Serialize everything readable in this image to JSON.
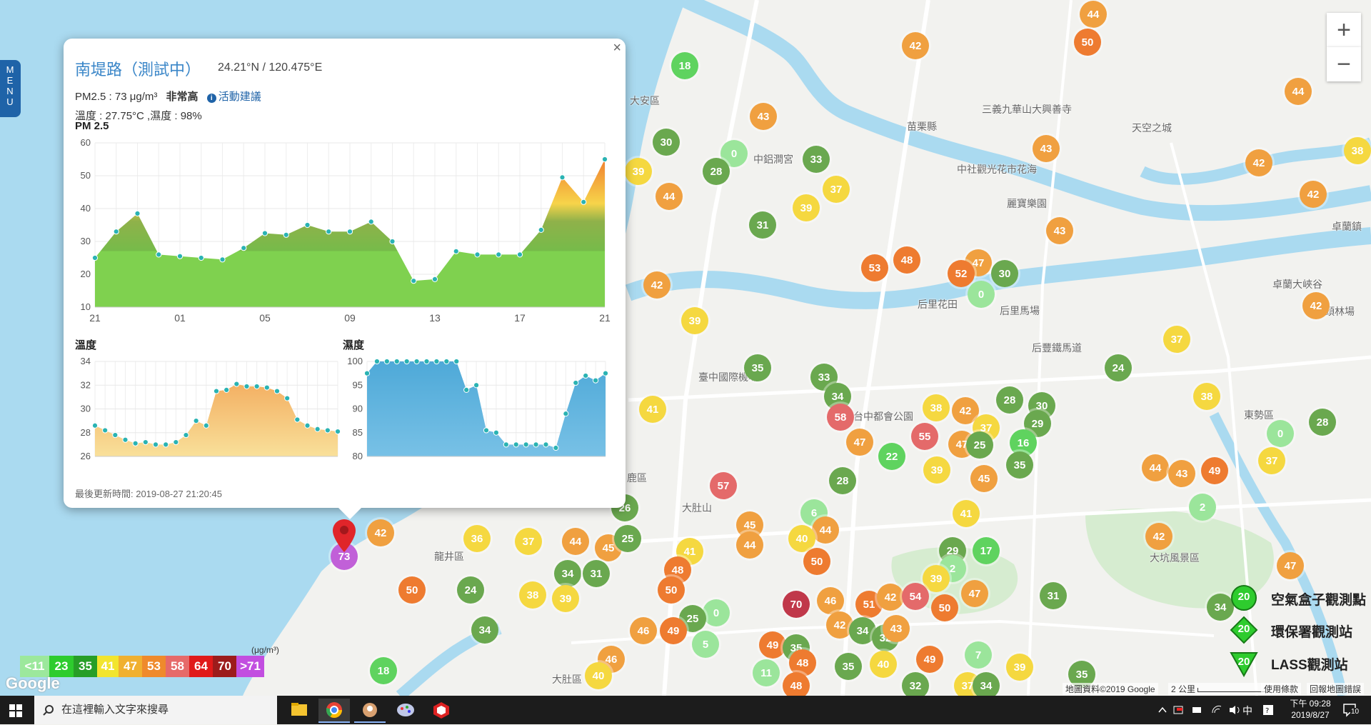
{
  "menu": {
    "label": "MENU"
  },
  "zoom": {
    "in": "+",
    "out": "−"
  },
  "places": [
    {
      "name": "大安區",
      "x": 882,
      "y": 140
    },
    {
      "name": "苗栗縣",
      "x": 1270,
      "y": 176
    },
    {
      "name": "三義九華山大興善寺",
      "x": 1375,
      "y": 152
    },
    {
      "name": "天空之城",
      "x": 1585,
      "y": 178
    },
    {
      "name": "中社觀光花市花海",
      "x": 1340,
      "y": 236
    },
    {
      "name": "卓蘭鎮",
      "x": 1865,
      "y": 316
    },
    {
      "name": "中鋁澗宮",
      "x": 1055,
      "y": 222
    },
    {
      "name": "麗寶樂園",
      "x": 1410,
      "y": 284
    },
    {
      "name": "后里花田",
      "x": 1285,
      "y": 425
    },
    {
      "name": "后里馬場",
      "x": 1400,
      "y": 434
    },
    {
      "name": "后豐鐵馬道",
      "x": 1445,
      "y": 486
    },
    {
      "name": "臺中國際機場",
      "x": 978,
      "y": 527
    },
    {
      "name": "台中都會公園",
      "x": 1195,
      "y": 582
    },
    {
      "name": "東勢區",
      "x": 1742,
      "y": 580
    },
    {
      "name": "鹿區",
      "x": 878,
      "y": 668
    },
    {
      "name": "大肚山",
      "x": 955,
      "y": 710
    },
    {
      "name": "龍井區",
      "x": 608,
      "y": 778
    },
    {
      "name": "大坑風景區",
      "x": 1610,
      "y": 780
    },
    {
      "name": "大肚區",
      "x": 773,
      "y": 950
    },
    {
      "name": "卓蘭大峽谷",
      "x": 1782,
      "y": 397
    },
    {
      "name": "頭林場",
      "x": 1855,
      "y": 435
    }
  ],
  "markers": [
    {
      "v": "44",
      "x": 1531,
      "y": 20,
      "c": "#f0a040"
    },
    {
      "v": "50",
      "x": 1523,
      "y": 59,
      "c": "#ee7b30"
    },
    {
      "v": "42",
      "x": 1282,
      "y": 64,
      "c": "#f0a040"
    },
    {
      "v": "18",
      "x": 959,
      "y": 92,
      "c": "#5fd35f"
    },
    {
      "v": "44",
      "x": 1818,
      "y": 128,
      "c": "#f0a040"
    },
    {
      "v": "43",
      "x": 1069,
      "y": 163,
      "c": "#f0a040"
    },
    {
      "v": "30",
      "x": 933,
      "y": 199,
      "c": "#6aa84f"
    },
    {
      "v": "0",
      "x": 1028,
      "y": 215,
      "c": "#9be59b"
    },
    {
      "v": "28",
      "x": 1003,
      "y": 240,
      "c": "#6aa84f"
    },
    {
      "v": "33",
      "x": 1143,
      "y": 223,
      "c": "#6aa84f"
    },
    {
      "v": "43",
      "x": 1465,
      "y": 208,
      "c": "#f0a040"
    },
    {
      "v": "42",
      "x": 1763,
      "y": 228,
      "c": "#f0a040"
    },
    {
      "v": "38",
      "x": 1901,
      "y": 211,
      "c": "#f5d840"
    },
    {
      "v": "39",
      "x": 894,
      "y": 240,
      "c": "#f5d840"
    },
    {
      "v": "37",
      "x": 1171,
      "y": 265,
      "c": "#f5d840"
    },
    {
      "v": "44",
      "x": 937,
      "y": 275,
      "c": "#f0a040"
    },
    {
      "v": "42",
      "x": 1839,
      "y": 272,
      "c": "#f0a040"
    },
    {
      "v": "39",
      "x": 1129,
      "y": 291,
      "c": "#f5d840"
    },
    {
      "v": "31",
      "x": 1068,
      "y": 315,
      "c": "#6aa84f"
    },
    {
      "v": "43",
      "x": 1484,
      "y": 323,
      "c": "#f0a040"
    },
    {
      "v": "48",
      "x": 1270,
      "y": 364,
      "c": "#ee7b30"
    },
    {
      "v": "53",
      "x": 1225,
      "y": 375,
      "c": "#ee7b30"
    },
    {
      "v": "47",
      "x": 1370,
      "y": 368,
      "c": "#f0a040"
    },
    {
      "v": "52",
      "x": 1346,
      "y": 383,
      "c": "#ee7b30"
    },
    {
      "v": "30",
      "x": 1407,
      "y": 383,
      "c": "#6aa84f"
    },
    {
      "v": "0",
      "x": 1374,
      "y": 412,
      "c": "#9be59b"
    },
    {
      "v": "42",
      "x": 920,
      "y": 399,
      "c": "#f0a040"
    },
    {
      "v": "42",
      "x": 1843,
      "y": 428,
      "c": "#f0a040"
    },
    {
      "v": "39",
      "x": 973,
      "y": 449,
      "c": "#f5d840"
    },
    {
      "v": "37",
      "x": 1648,
      "y": 475,
      "c": "#f5d840"
    },
    {
      "v": "35",
      "x": 1061,
      "y": 515,
      "c": "#6aa84f"
    },
    {
      "v": "24",
      "x": 1566,
      "y": 515,
      "c": "#6aa84f"
    },
    {
      "v": "33",
      "x": 1154,
      "y": 528,
      "c": "#6aa84f"
    },
    {
      "v": "34",
      "x": 1173,
      "y": 555,
      "c": "#6aa84f"
    },
    {
      "v": "28",
      "x": 1414,
      "y": 560,
      "c": "#6aa84f"
    },
    {
      "v": "30",
      "x": 1459,
      "y": 568,
      "c": "#6aa84f"
    },
    {
      "v": "38",
      "x": 1690,
      "y": 555,
      "c": "#f5d840"
    },
    {
      "v": "41",
      "x": 914,
      "y": 573,
      "c": "#f5d840"
    },
    {
      "v": "58",
      "x": 1177,
      "y": 584,
      "c": "#e46a6a"
    },
    {
      "v": "38",
      "x": 1311,
      "y": 571,
      "c": "#f5d840"
    },
    {
      "v": "42",
      "x": 1352,
      "y": 575,
      "c": "#f0a040"
    },
    {
      "v": "29",
      "x": 1453,
      "y": 593,
      "c": "#6aa84f"
    },
    {
      "v": "28",
      "x": 1852,
      "y": 591,
      "c": "#6aa84f"
    },
    {
      "v": "0",
      "x": 1793,
      "y": 607,
      "c": "#9be59b"
    },
    {
      "v": "55",
      "x": 1295,
      "y": 611,
      "c": "#e46a6a"
    },
    {
      "v": "37",
      "x": 1381,
      "y": 599,
      "c": "#f5d840"
    },
    {
      "v": "47",
      "x": 1204,
      "y": 619,
      "c": "#f0a040"
    },
    {
      "v": "47",
      "x": 1347,
      "y": 622,
      "c": "#f0a040"
    },
    {
      "v": "25",
      "x": 1372,
      "y": 623,
      "c": "#6aa84f"
    },
    {
      "v": "16",
      "x": 1433,
      "y": 620,
      "c": "#5fd35f"
    },
    {
      "v": "22",
      "x": 1249,
      "y": 639,
      "c": "#5fd35f"
    },
    {
      "v": "39",
      "x": 1312,
      "y": 658,
      "c": "#f5d840"
    },
    {
      "v": "35",
      "x": 1428,
      "y": 651,
      "c": "#6aa84f"
    },
    {
      "v": "37",
      "x": 1781,
      "y": 645,
      "c": "#f5d840"
    },
    {
      "v": "45",
      "x": 1378,
      "y": 670,
      "c": "#f0a040"
    },
    {
      "v": "28",
      "x": 1180,
      "y": 673,
      "c": "#6aa84f"
    },
    {
      "v": "57",
      "x": 1013,
      "y": 680,
      "c": "#e46a6a"
    },
    {
      "v": "44",
      "x": 1618,
      "y": 655,
      "c": "#f0a040"
    },
    {
      "v": "43",
      "x": 1655,
      "y": 663,
      "c": "#f0a040"
    },
    {
      "v": "49",
      "x": 1701,
      "y": 659,
      "c": "#ee7b30"
    },
    {
      "v": "2",
      "x": 1684,
      "y": 710,
      "c": "#9be59b"
    },
    {
      "v": "26",
      "x": 875,
      "y": 711,
      "c": "#6aa84f"
    },
    {
      "v": "6",
      "x": 1140,
      "y": 718,
      "c": "#9be59b"
    },
    {
      "v": "41",
      "x": 1353,
      "y": 719,
      "c": "#f5d840"
    },
    {
      "v": "42",
      "x": 533,
      "y": 746,
      "c": "#f0a040"
    },
    {
      "v": "73",
      "x": 482,
      "y": 779,
      "c": "#c160d8"
    },
    {
      "v": "36",
      "x": 668,
      "y": 754,
      "c": "#f5d840"
    },
    {
      "v": "37",
      "x": 740,
      "y": 758,
      "c": "#f5d840"
    },
    {
      "v": "44",
      "x": 806,
      "y": 758,
      "c": "#f0a040"
    },
    {
      "v": "45",
      "x": 852,
      "y": 767,
      "c": "#f0a040"
    },
    {
      "v": "25",
      "x": 879,
      "y": 754,
      "c": "#6aa84f"
    },
    {
      "v": "45",
      "x": 1050,
      "y": 735,
      "c": "#f0a040"
    },
    {
      "v": "44",
      "x": 1050,
      "y": 763,
      "c": "#f0a040"
    },
    {
      "v": "44",
      "x": 1156,
      "y": 742,
      "c": "#f0a040"
    },
    {
      "v": "40",
      "x": 1123,
      "y": 754,
      "c": "#f5d840"
    },
    {
      "v": "29",
      "x": 1334,
      "y": 771,
      "c": "#6aa84f"
    },
    {
      "v": "17",
      "x": 1381,
      "y": 771,
      "c": "#5fd35f"
    },
    {
      "v": "42",
      "x": 1623,
      "y": 751,
      "c": "#f0a040"
    },
    {
      "v": "41",
      "x": 966,
      "y": 772,
      "c": "#f5d840"
    },
    {
      "v": "48",
      "x": 949,
      "y": 798,
      "c": "#ee7b30"
    },
    {
      "v": "50",
      "x": 1144,
      "y": 786,
      "c": "#ee7b30"
    },
    {
      "v": "2",
      "x": 1334,
      "y": 796,
      "c": "#9be59b"
    },
    {
      "v": "34",
      "x": 795,
      "y": 803,
      "c": "#6aa84f"
    },
    {
      "v": "31",
      "x": 835,
      "y": 803,
      "c": "#6aa84f"
    },
    {
      "v": "39",
      "x": 1311,
      "y": 810,
      "c": "#f5d840"
    },
    {
      "v": "47",
      "x": 1807,
      "y": 792,
      "c": "#f0a040"
    },
    {
      "v": "50",
      "x": 577,
      "y": 826,
      "c": "#ee7b30"
    },
    {
      "v": "24",
      "x": 659,
      "y": 826,
      "c": "#6aa84f"
    },
    {
      "v": "50",
      "x": 940,
      "y": 826,
      "c": "#ee7b30"
    },
    {
      "v": "46",
      "x": 1163,
      "y": 841,
      "c": "#f0a040"
    },
    {
      "v": "51",
      "x": 1217,
      "y": 846,
      "c": "#ee7b30"
    },
    {
      "v": "42",
      "x": 1247,
      "y": 836,
      "c": "#f0a040"
    },
    {
      "v": "54",
      "x": 1282,
      "y": 835,
      "c": "#e46a6a"
    },
    {
      "v": "50",
      "x": 1323,
      "y": 851,
      "c": "#ee7b30"
    },
    {
      "v": "47",
      "x": 1365,
      "y": 831,
      "c": "#f0a040"
    },
    {
      "v": "31",
      "x": 1475,
      "y": 834,
      "c": "#6aa84f"
    },
    {
      "v": "38",
      "x": 746,
      "y": 833,
      "c": "#f5d840"
    },
    {
      "v": "39",
      "x": 792,
      "y": 838,
      "c": "#f5d840"
    },
    {
      "v": "70",
      "x": 1115,
      "y": 846,
      "c": "#c0384a"
    },
    {
      "v": "34",
      "x": 1709,
      "y": 850,
      "c": "#6aa84f"
    },
    {
      "v": "0",
      "x": 1003,
      "y": 858,
      "c": "#9be59b"
    },
    {
      "v": "25",
      "x": 970,
      "y": 866,
      "c": "#6aa84f"
    },
    {
      "v": "49",
      "x": 943,
      "y": 883,
      "c": "#ee7b30"
    },
    {
      "v": "46",
      "x": 901,
      "y": 883,
      "c": "#f0a040"
    },
    {
      "v": "42",
      "x": 1176,
      "y": 875,
      "c": "#f0a040"
    },
    {
      "v": "34",
      "x": 1208,
      "y": 883,
      "c": "#6aa84f"
    },
    {
      "v": "32",
      "x": 1240,
      "y": 893,
      "c": "#6aa84f"
    },
    {
      "v": "43",
      "x": 1255,
      "y": 880,
      "c": "#f0a040"
    },
    {
      "v": "34",
      "x": 679,
      "y": 882,
      "c": "#6aa84f"
    },
    {
      "v": "5",
      "x": 988,
      "y": 902,
      "c": "#9be59b"
    },
    {
      "v": "49",
      "x": 1082,
      "y": 903,
      "c": "#ee7b30"
    },
    {
      "v": "35",
      "x": 1115,
      "y": 907,
      "c": "#6aa84f"
    },
    {
      "v": "7",
      "x": 1370,
      "y": 917,
      "c": "#9be59b"
    },
    {
      "v": "46",
      "x": 856,
      "y": 923,
      "c": "#f0a040"
    },
    {
      "v": "48",
      "x": 1124,
      "y": 928,
      "c": "#ee7b30"
    },
    {
      "v": "49",
      "x": 1302,
      "y": 923,
      "c": "#ee7b30"
    },
    {
      "v": "35",
      "x": 1188,
      "y": 933,
      "c": "#6aa84f"
    },
    {
      "v": "40",
      "x": 1237,
      "y": 930,
      "c": "#f5d840"
    },
    {
      "v": "39",
      "x": 1428,
      "y": 934,
      "c": "#f5d840"
    },
    {
      "v": "18",
      "x": 537,
      "y": 939,
      "c": "#5fd35f"
    },
    {
      "v": "40",
      "x": 838,
      "y": 946,
      "c": "#f5d840"
    },
    {
      "v": "11",
      "x": 1073,
      "y": 942,
      "c": "#9be59b"
    },
    {
      "v": "35",
      "x": 1515,
      "y": 944,
      "c": "#6aa84f"
    },
    {
      "v": "48",
      "x": 1115,
      "y": 960,
      "c": "#ee7b30"
    },
    {
      "v": "32",
      "x": 1282,
      "y": 960,
      "c": "#6aa84f"
    },
    {
      "v": "37",
      "x": 1355,
      "y": 960,
      "c": "#f5d840"
    },
    {
      "v": "34",
      "x": 1381,
      "y": 960,
      "c": "#6aa84f"
    }
  ],
  "popup": {
    "title": "南堤路（測試中）",
    "coord": "24.21°N / 120.475°E",
    "pm_text": "PM2.5 : 73 μg/m³",
    "pm_level": "非常高",
    "advice": "活動建議",
    "info_icon": "i",
    "temp_hum": "溫度 : 27.75°C ,濕度 : 98%",
    "pm_chart_title": "PM 2.5",
    "temp_chart_title": "溫度",
    "hum_chart_title": "濕度",
    "update": "最後更新時間: 2019-08-27 21:20:45",
    "close": "×"
  },
  "chart_data": [
    {
      "type": "area",
      "title": "PM 2.5",
      "x": [
        "21",
        "",
        "",
        "",
        "01",
        "",
        "",
        "",
        "05",
        "",
        "",
        "",
        "09",
        "",
        "",
        "",
        "13",
        "",
        "",
        "",
        "17",
        "",
        "",
        "",
        "21"
      ],
      "xticks": [
        "21",
        "01",
        "05",
        "09",
        "13",
        "17",
        "21"
      ],
      "ylim": [
        10,
        60
      ],
      "yticks": [
        10,
        20,
        30,
        40,
        50,
        60
      ],
      "values": [
        25,
        33,
        38.5,
        26,
        25.5,
        25,
        24.5,
        28,
        32.5,
        32,
        35,
        33,
        33,
        36,
        30,
        18,
        18.5,
        27,
        26,
        26,
        26,
        33.5,
        49.5,
        42,
        55
      ]
    },
    {
      "type": "area",
      "title": "溫度",
      "ylim": [
        26,
        34
      ],
      "yticks": [
        26,
        28,
        30,
        32,
        34
      ],
      "values": [
        28.6,
        28.2,
        27.8,
        27.4,
        27.1,
        27.2,
        27.0,
        27.0,
        27.2,
        27.8,
        29.0,
        28.6,
        31.5,
        31.6,
        32.1,
        31.9,
        31.9,
        31.8,
        31.5,
        30.9,
        29.1,
        28.6,
        28.3,
        28.2,
        28.1
      ]
    },
    {
      "type": "area",
      "title": "濕度",
      "ylim": [
        80,
        100
      ],
      "yticks": [
        80,
        85,
        90,
        95,
        100
      ],
      "values": [
        97.5,
        100,
        100,
        100,
        100,
        100,
        100,
        100,
        100,
        100,
        94,
        95,
        85.5,
        85,
        82.5,
        82.5,
        82.5,
        82.5,
        82.5,
        81.8,
        89,
        95.5,
        97,
        96,
        97.5
      ]
    }
  ],
  "legend": {
    "unit": "(μg/m³)",
    "items": [
      {
        "label": "<11",
        "c": "#9ce89c"
      },
      {
        "label": "23",
        "c": "#2ecc2e"
      },
      {
        "label": "35",
        "c": "#279e27"
      },
      {
        "label": "41",
        "c": "#f2e52e"
      },
      {
        "label": "47",
        "c": "#f0b030"
      },
      {
        "label": "53",
        "c": "#ef8a2c"
      },
      {
        "label": "58",
        "c": "#e66a6a"
      },
      {
        "label": "64",
        "c": "#e01a1a"
      },
      {
        "label": "70",
        "c": "#9c1c1c"
      },
      {
        "label": ">71",
        "c": "#c24ee0"
      }
    ]
  },
  "kinds": [
    {
      "label": "空氣盒子觀測點",
      "num": "20",
      "shape": "circle"
    },
    {
      "label": "環保署觀測站",
      "num": "20",
      "shape": "diamond"
    },
    {
      "label": "LASS觀測站",
      "num": "20",
      "shape": "triangle"
    }
  ],
  "attribution": {
    "map": "地圖資料©2019 Google",
    "scale": "2 公里",
    "terms": "使用條款",
    "report": "回報地圖錯誤",
    "logo": "Google"
  },
  "taskbar": {
    "search": "在這裡輸入文字來搜尋",
    "ampm": "下午 09:28",
    "date": "2019/8/27",
    "ime": "中",
    "notif": "10"
  }
}
